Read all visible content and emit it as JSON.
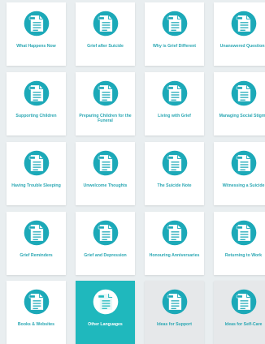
{
  "colors": {
    "accent": "#2aa7b3",
    "active_tile": "#1fb8bd",
    "tile": "#ffffff",
    "muted_tile": "#e6e8ea",
    "background": "#e9eef0"
  },
  "tiles": [
    {
      "label": "What Happens Now",
      "icon": "document-icon"
    },
    {
      "label": "Grief after Suicide",
      "icon": "document-icon"
    },
    {
      "label": "Why is Grief Different",
      "icon": "document-icon"
    },
    {
      "label": "Unanswered Questions",
      "icon": "document-icon"
    },
    {
      "label": "Supporting Children",
      "icon": "document-icon"
    },
    {
      "label": "Preparing Children for the Funeral",
      "icon": "document-icon"
    },
    {
      "label": "Living with Grief",
      "icon": "document-icon"
    },
    {
      "label": "Managing Social Stigma",
      "icon": "document-icon"
    },
    {
      "label": "Having Trouble Sleeping",
      "icon": "document-icon"
    },
    {
      "label": "Unwelcome Thoughts",
      "icon": "document-icon"
    },
    {
      "label": "The Suicide Note",
      "icon": "document-icon"
    },
    {
      "label": "Witnessing a Suicide",
      "icon": "document-icon"
    },
    {
      "label": "Grief Reminders",
      "icon": "document-icon"
    },
    {
      "label": "Grief and Depression",
      "icon": "document-icon"
    },
    {
      "label": "Honouring Anniversaries",
      "icon": "document-icon"
    },
    {
      "label": "Returning to Work",
      "icon": "document-icon"
    },
    {
      "label": "Books & Websites",
      "icon": "document-icon"
    },
    {
      "label": "Other Languages",
      "icon": "document-icon",
      "state": "active"
    },
    {
      "label": "Ideas for Support",
      "icon": "document-icon",
      "state": "muted"
    },
    {
      "label": "Ideas for Self-Care",
      "icon": "document-icon",
      "state": "muted"
    }
  ]
}
